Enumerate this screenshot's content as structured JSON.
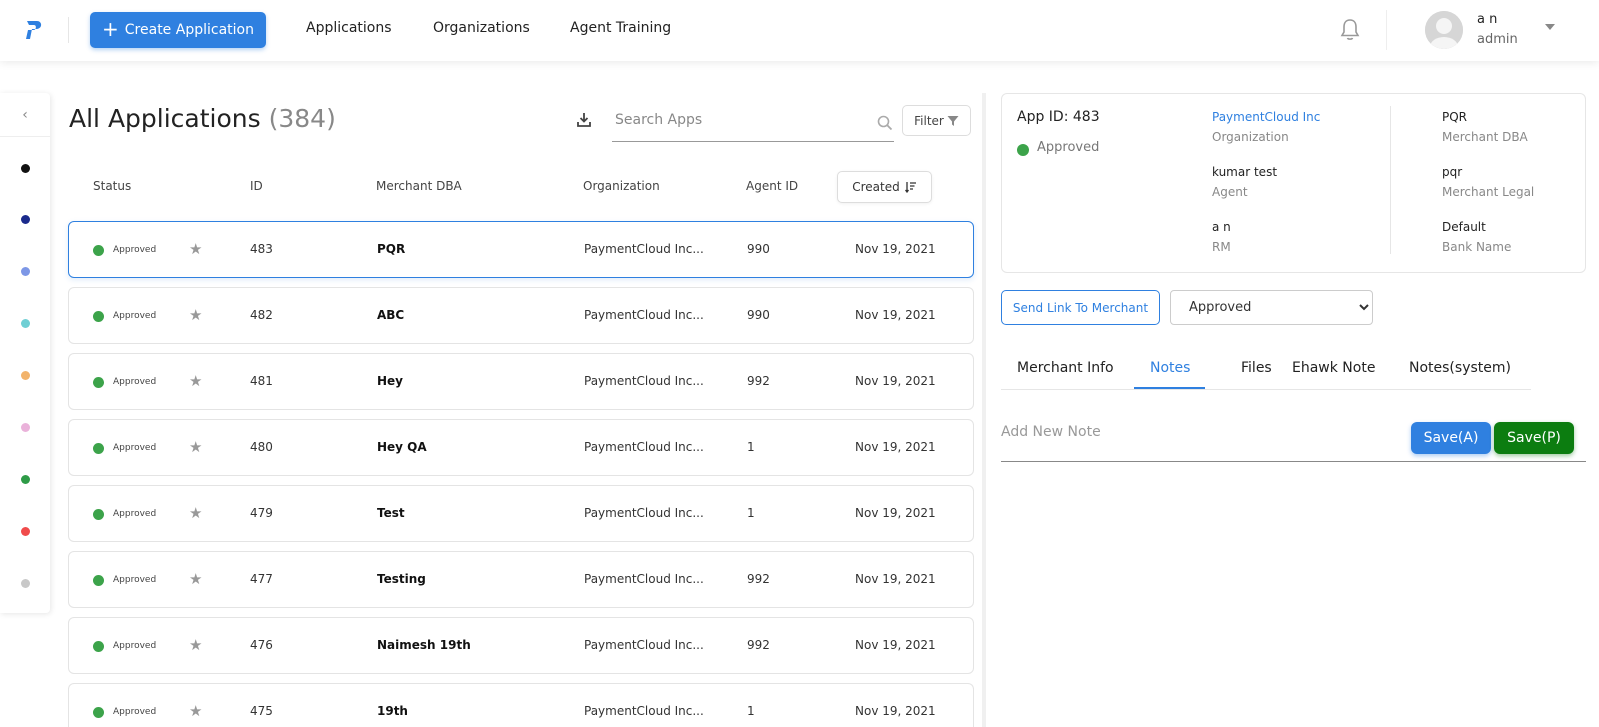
{
  "nav": {
    "create_label": "Create Application",
    "links": [
      "Applications",
      "Organizations",
      "Agent Training"
    ],
    "user_name": "a n",
    "user_role": "admin"
  },
  "rail": {
    "collapse_glyph": "‹",
    "dots": [
      "#111111",
      "#1b2a8c",
      "#7d97e6",
      "#6fcfd4",
      "#f2b36b",
      "#eab2da",
      "#2e9b47",
      "#f04b4b",
      "#c8c8c8"
    ]
  },
  "list": {
    "title": "All Applications",
    "count": "(384)",
    "search_placeholder": "Search Apps",
    "filter_label": "Filter",
    "columns": {
      "status": "Status",
      "id": "ID",
      "dba": "Merchant DBA",
      "org": "Organization",
      "agent": "Agent ID",
      "created": "Created"
    },
    "rows": [
      {
        "status": "Approved",
        "id": "483",
        "dba": "PQR",
        "org": "PaymentCloud Inc...",
        "agent": "990",
        "date": "Nov 19, 2021"
      },
      {
        "status": "Approved",
        "id": "482",
        "dba": "ABC",
        "org": "PaymentCloud Inc...",
        "agent": "990",
        "date": "Nov 19, 2021"
      },
      {
        "status": "Approved",
        "id": "481",
        "dba": "Hey",
        "org": "PaymentCloud Inc...",
        "agent": "992",
        "date": "Nov 19, 2021"
      },
      {
        "status": "Approved",
        "id": "480",
        "dba": "Hey QA",
        "org": "PaymentCloud Inc...",
        "agent": "1",
        "date": "Nov 19, 2021"
      },
      {
        "status": "Approved",
        "id": "479",
        "dba": "Test",
        "org": "PaymentCloud Inc...",
        "agent": "1",
        "date": "Nov 19, 2021"
      },
      {
        "status": "Approved",
        "id": "477",
        "dba": "Testing",
        "org": "PaymentCloud Inc...",
        "agent": "992",
        "date": "Nov 19, 2021"
      },
      {
        "status": "Approved",
        "id": "476",
        "dba": "Naimesh 19th",
        "org": "PaymentCloud Inc...",
        "agent": "992",
        "date": "Nov 19, 2021"
      },
      {
        "status": "Approved",
        "id": "475",
        "dba": "19th",
        "org": "PaymentCloud Inc...",
        "agent": "1",
        "date": "Nov 19, 2021"
      }
    ]
  },
  "detail": {
    "app_id": "App ID: 483",
    "status": "Approved",
    "org_value": "PaymentCloud Inc",
    "org_label": "Organization",
    "agent_value": "kumar test",
    "agent_label": "Agent",
    "rm_value": "a n",
    "rm_label": "RM",
    "dba_value": "PQR",
    "dba_label": "Merchant DBA",
    "legal_value": "pqr",
    "legal_label": "Merchant Legal",
    "bank_value": "Default",
    "bank_label": "Bank Name",
    "send_link_label": "Send Link To Merchant",
    "status_select": "Approved",
    "tabs": [
      "Merchant Info",
      "Notes",
      "Files",
      "Ehawk Note",
      "Notes(system)"
    ],
    "active_tab": "Notes",
    "note_placeholder": "Add New Note",
    "save_a": "Save(A)",
    "save_p": "Save(P)"
  },
  "colors": {
    "accent": "#2f80e0",
    "approved": "#3ca34a",
    "save_p": "#0c7d10"
  }
}
